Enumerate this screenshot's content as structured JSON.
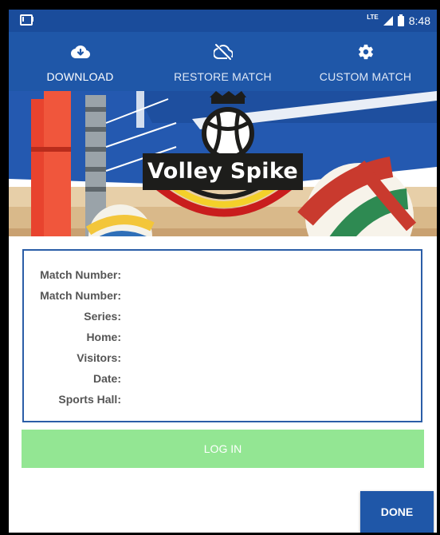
{
  "status_bar": {
    "time": "8:48",
    "network": "LTE"
  },
  "tabs": [
    {
      "label": "DOWNLOAD",
      "icon": "cloud-download-icon",
      "active": true
    },
    {
      "label": "RESTORE MATCH",
      "icon": "cloud-off-icon",
      "active": false
    },
    {
      "label": "CUSTOM MATCH",
      "icon": "gear-icon",
      "active": false
    }
  ],
  "banner": {
    "logo_text": "Volley Spike"
  },
  "match_info": {
    "rows": [
      {
        "label": "Match Number:"
      },
      {
        "label": "Match Number:"
      },
      {
        "label": "Series:"
      },
      {
        "label": "Home:"
      },
      {
        "label": "Visitors:"
      },
      {
        "label": "Date:"
      },
      {
        "label": "Sports Hall:"
      }
    ]
  },
  "buttons": {
    "login": "LOG IN",
    "done": "DONE"
  },
  "colors": {
    "primary": "#1f57a8",
    "status_bar": "#1a4c9b",
    "login_disabled": "#93e693",
    "card_border": "#2b5ea7"
  }
}
